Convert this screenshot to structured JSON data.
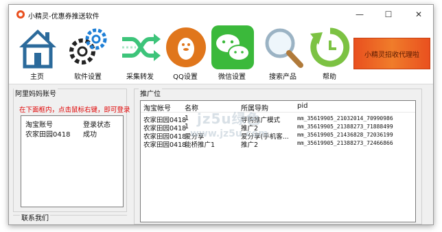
{
  "window": {
    "title": "小精灵-优惠券推送软件",
    "minimize": "—",
    "maximize": "☐",
    "close": "✕"
  },
  "toolbar": {
    "items": [
      {
        "label": "主页",
        "icon": "home-icon"
      },
      {
        "label": "软件设置",
        "icon": "gears-icon"
      },
      {
        "label": "采集转发",
        "icon": "shuffle-icon"
      },
      {
        "label": "QQ设置",
        "icon": "qq-penguin-icon"
      },
      {
        "label": "微信设置",
        "icon": "wechat-icon"
      },
      {
        "label": "搜索产品",
        "icon": "magnifier-icon"
      },
      {
        "label": "帮助",
        "icon": "refresh-icon"
      }
    ],
    "banner": "小精灵招收代理啦"
  },
  "accounts": {
    "group_title": "阿里妈妈账号",
    "hint": "在下面框内，点击鼠标右键，即可登录",
    "headers": [
      "淘宝账号",
      "登录状态"
    ],
    "rows": [
      [
        "农家田园0418",
        "成功"
      ]
    ]
  },
  "contact": {
    "group_title": "联系我们"
  },
  "adzones": {
    "group_title": "推广位",
    "headers": [
      "淘宝帐号",
      "名称",
      "所属导购",
      "pid"
    ],
    "rows": [
      [
        "农家田园0418",
        "1",
        "导购推广模式",
        "mm_35619905_21032014_70990986"
      ],
      [
        "农家田园0418",
        "1",
        "推广2",
        "mm_35619905_21388273_71888499"
      ],
      [
        "农家田园0418",
        "爱分享",
        "爱分享(手机客...",
        "mm_35619905_21436828_72036199"
      ],
      [
        "农家田园0418",
        "能桥推广1",
        "推广2",
        "mm_35619905_21388273_72466866"
      ]
    ]
  },
  "watermark": {
    "line1": "jz5u绿色",
    "line2": "www.jz5u.com"
  },
  "colors": {
    "hint_red": "#e00000",
    "banner_orange": "#e9501f",
    "home_blue": "#2b6a9b",
    "wechat_green": "#3bb93b",
    "qq_orange": "#e0761c"
  }
}
